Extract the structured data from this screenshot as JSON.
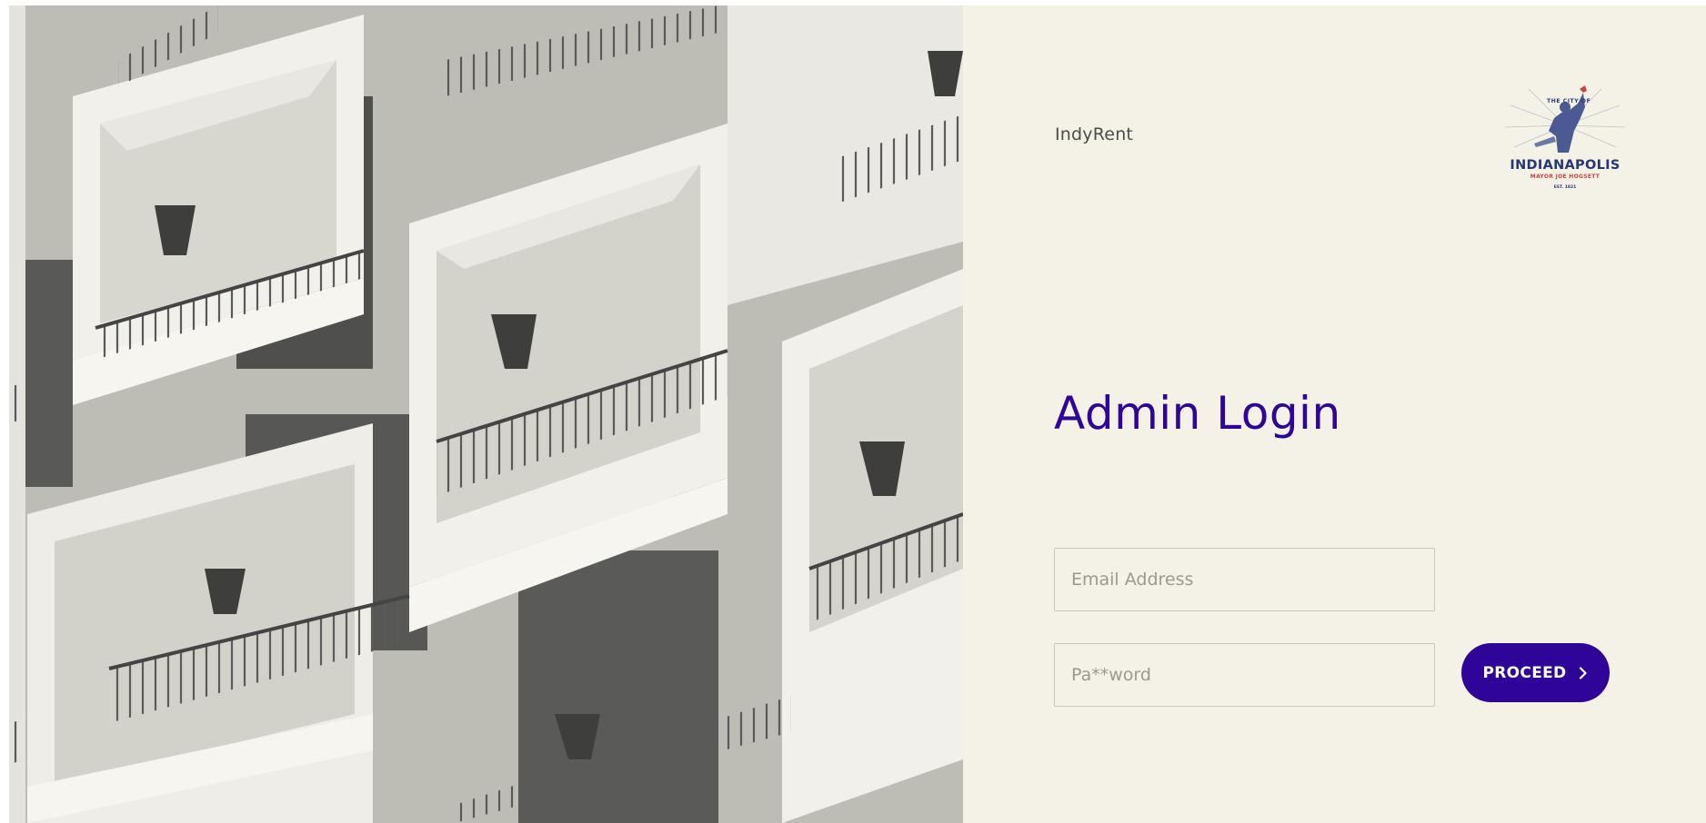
{
  "brand": {
    "name": "IndyRent"
  },
  "seal": {
    "icon": "city-seal-icon",
    "top_text": "THE CITY OF",
    "city": "INDIANAPOLIS",
    "mayor": "MAYOR JOE HOGSETT",
    "est": "EST. 1821"
  },
  "login": {
    "title": "Admin Login",
    "email": {
      "placeholder": "Email Address",
      "value": ""
    },
    "password": {
      "placeholder": "Pa**word",
      "value": ""
    },
    "proceed_label": "PROCEED",
    "proceed_icon": "chevron-right-icon"
  },
  "colors": {
    "accent": "#2f0599",
    "panel_background": "#f4f2e6",
    "field_border": "#c9c6bb",
    "seal_blue": "#263778",
    "seal_red": "#d24040"
  }
}
